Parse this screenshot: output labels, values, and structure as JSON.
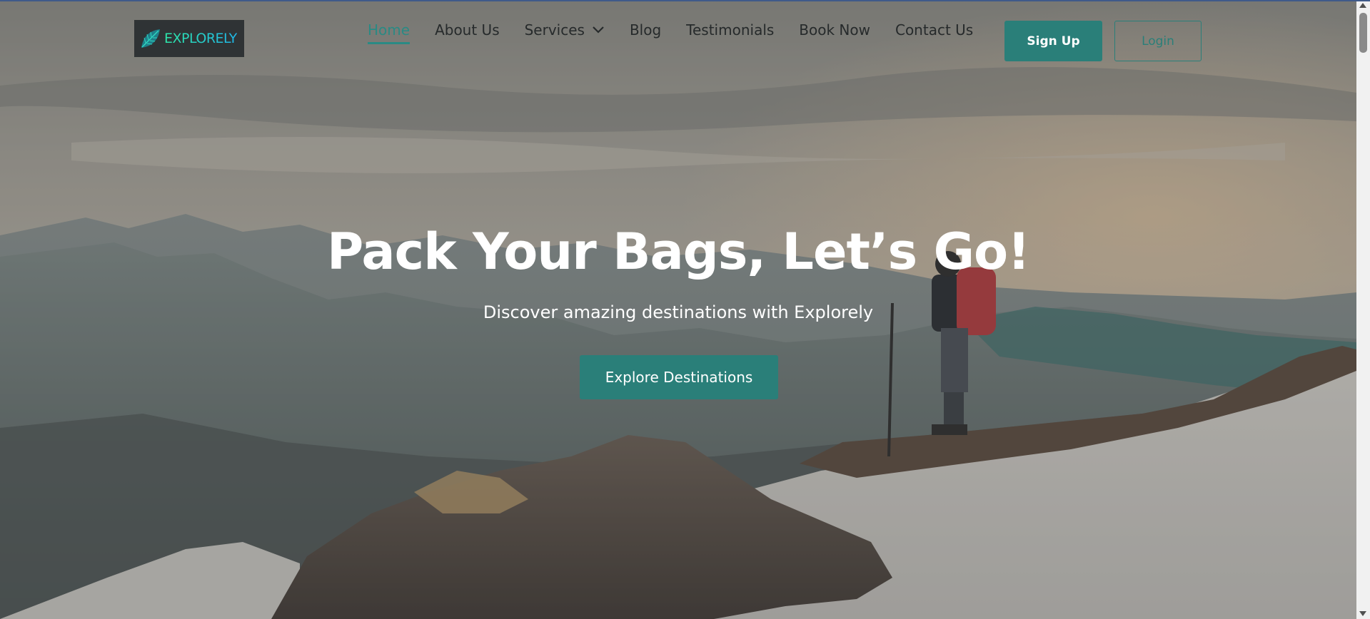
{
  "brand": {
    "name": "EXPLORELY",
    "logo_icon": "leaf-icon"
  },
  "nav": {
    "items": [
      {
        "label": "Home",
        "active": true
      },
      {
        "label": "About Us"
      },
      {
        "label": "Services",
        "has_dropdown": true
      },
      {
        "label": "Blog"
      },
      {
        "label": "Testimonials"
      },
      {
        "label": "Book Now"
      },
      {
        "label": "Contact Us"
      }
    ],
    "signup_label": "Sign Up",
    "login_label": "Login"
  },
  "hero": {
    "title": "Pack Your Bags, Let’s Go!",
    "subtitle": "Discover amazing destinations with Explorely",
    "cta_label": "Explore Destinations"
  },
  "colors": {
    "accent": "#2a7f79",
    "active_nav": "#2a8a84",
    "nav_text": "#262a2b",
    "logo_bg": "#2f3335"
  }
}
